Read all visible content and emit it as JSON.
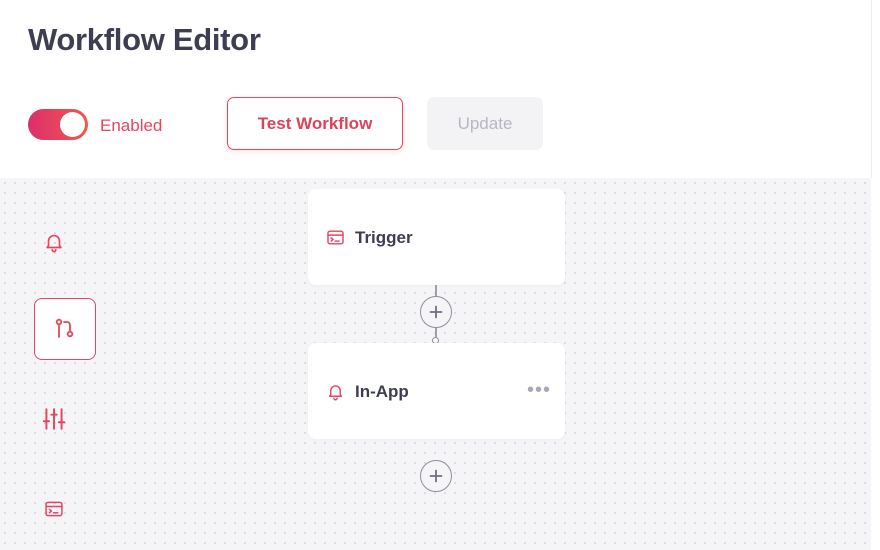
{
  "header": {
    "title": "Workflow Editor",
    "toggle": {
      "label": "Enabled",
      "on": true
    },
    "test_button": "Test Workflow",
    "update_button": "Update"
  },
  "sidebar": {
    "items": [
      {
        "icon": "bell-icon",
        "active": false
      },
      {
        "icon": "git-branch-icon",
        "active": true
      },
      {
        "icon": "sliders-icon",
        "active": false
      },
      {
        "icon": "terminal-card-icon",
        "active": false
      }
    ]
  },
  "nodes": [
    {
      "label": "Trigger",
      "icon": "terminal-card-icon"
    },
    {
      "label": "In-App",
      "icon": "bell-icon",
      "menu": "•••"
    }
  ],
  "colors": {
    "accent": "#e5455f",
    "accent_gradient_start": "#dd2e6c",
    "accent_gradient_end": "#ef5a4e",
    "canvas_bg": "#f5f5f8",
    "title_text": "#3e3e52",
    "disabled_bg": "#f3f3f6",
    "disabled_text": "#b6b6c4"
  }
}
